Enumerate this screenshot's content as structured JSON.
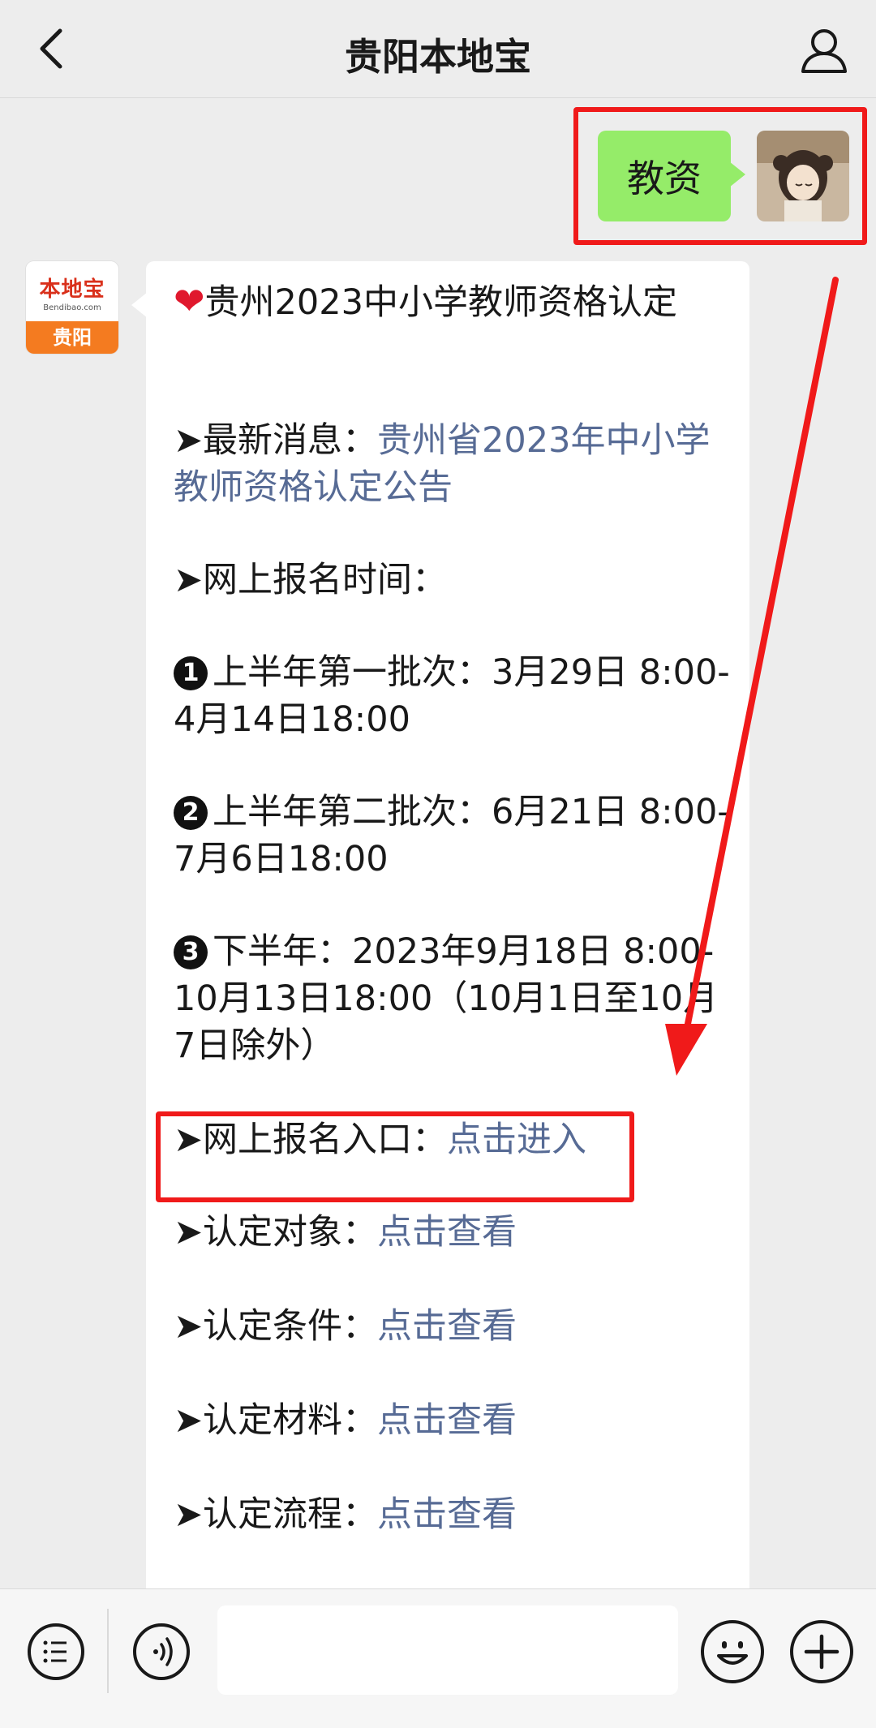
{
  "nav": {
    "title": "贵阳本地宝"
  },
  "sent": {
    "text": "教资"
  },
  "bot": {
    "logo_text": "本地宝",
    "logo_sub": "Bendibao.com",
    "logo_city": "贵阳"
  },
  "message": {
    "heading": "贵州2023中小学教师资格认定",
    "latest_label": "➤最新消息：",
    "latest_link": "贵州省2023年中小学教师资格认定公告",
    "time_label": "➤网上报名时间：",
    "batch1_num": "1",
    "batch1": "上半年第一批次：3月29日 8:00-4月14日18:00",
    "batch2_num": "2",
    "batch2": "上半年第二批次：6月21日 8:00-7月6日18:00",
    "batch3_num": "3",
    "batch3": "下半年：2023年9月18日 8:00-10月13日18:00（10月1日至10月7日除外）",
    "entry_label": "➤网上报名入口：",
    "entry_link": "点击进入",
    "target_label": "➤认定对象：",
    "target_link": "点击查看",
    "cond_label": "➤认定条件：",
    "cond_link": "点击查看",
    "material_label": "➤认定材料：",
    "material_link": "点击查看",
    "process_label": "➤认定流程：",
    "process_link": "点击查看"
  },
  "colors": {
    "highlight": "#f01a1a",
    "link": "#576b95",
    "sent_bubble": "#95ec69"
  },
  "icons": [
    "back-arrow-icon",
    "user-icon",
    "menu-icon",
    "voice-icon",
    "emoji-icon",
    "plus-icon"
  ]
}
